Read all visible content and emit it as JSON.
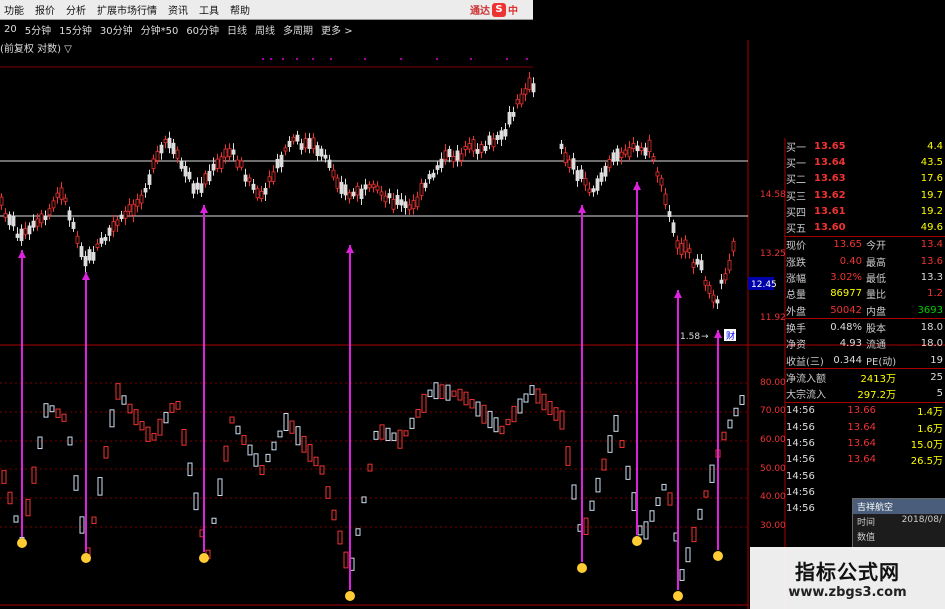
{
  "menu": {
    "items": [
      "功能",
      "报价",
      "分析",
      "扩展市场行情",
      "资讯",
      "工具",
      "帮助"
    ],
    "brand_text": "通达",
    "brand_s": "S",
    "brand_zh": "中"
  },
  "periods": [
    "20",
    "5分钟",
    "15分钟",
    "30分钟",
    "分钟*50",
    "60分钟",
    "日线",
    "周线",
    "多周期",
    "更多 >"
  ],
  "subtitle": "(前复权 对数) ▽",
  "price_axis": [
    "14.58",
    "13.25",
    "12.45",
    "11.92"
  ],
  "indicator_axis": [
    "80.00",
    "70.00",
    "60.00",
    "50.00",
    "40.00",
    "30.00"
  ],
  "annotation": {
    "value": "1.58",
    "arrow": "→",
    "tag": "财"
  },
  "current_price_tag": "12.45",
  "quote": {
    "bids": [
      {
        "label": "买一",
        "price": "13.65",
        "vol": "4.4"
      },
      {
        "label": "买一",
        "price": "13.64",
        "vol": "43.5"
      },
      {
        "label": "买二",
        "price": "13.63",
        "vol": "17.6"
      },
      {
        "label": "买三",
        "price": "13.62",
        "vol": "19.7"
      },
      {
        "label": "买四",
        "price": "13.61",
        "vol": "19.2"
      },
      {
        "label": "买五",
        "price": "13.60",
        "vol": "49.6"
      }
    ],
    "stats": [
      {
        "k1": "现价",
        "v1": "13.65",
        "k2": "今开",
        "v2": "13.4"
      },
      {
        "k1": "涨跌",
        "v1": "0.40",
        "k2": "最高",
        "v2": "13.6"
      },
      {
        "k1": "涨幅",
        "v1": "3.02%",
        "k2": "最低",
        "v2": "13.3"
      },
      {
        "k1": "总量",
        "v1": "86977",
        "k2": "量比",
        "v2": "1.2"
      },
      {
        "k1": "外盘",
        "v1": "50042",
        "k2": "内盘",
        "v2": "3693"
      }
    ],
    "fundamentals": [
      {
        "k1": "换手",
        "v1": "0.48%",
        "k2": "股本",
        "v2": "18.0"
      },
      {
        "k1": "净资",
        "v1": "4.93",
        "k2": "流通",
        "v2": "18.0"
      },
      {
        "k1": "收益(三)",
        "v1": "0.344",
        "k2": "PE(动)",
        "v2": "19"
      }
    ],
    "flows": [
      {
        "label": "净流入额",
        "value": "2413万",
        "extra": "25"
      },
      {
        "label": "大宗流入",
        "value": "297.2万",
        "extra": "5"
      }
    ],
    "ticks": [
      {
        "time": "14:56",
        "price": "13.66",
        "vol": "1.4万"
      },
      {
        "time": "14:56",
        "price": "13.64",
        "vol": "1.6万"
      },
      {
        "time": "14:56",
        "price": "13.64",
        "vol": "15.0万"
      },
      {
        "time": "14:56",
        "price": "13.64",
        "vol": "26.5万"
      },
      {
        "time": "14:56",
        "price": "",
        "vol": ""
      },
      {
        "time": "14:56",
        "price": "",
        "vol": ""
      },
      {
        "time": "14:56",
        "price": "",
        "vol": ""
      }
    ]
  },
  "popup": {
    "title": "吉祥航空",
    "row1_label": "时间",
    "row1_value": "2018/08/",
    "row2_label": "数值",
    "row2_value": ""
  },
  "watermark": {
    "line1": "指标公式网",
    "line2": "www.zbgs3.com"
  }
}
